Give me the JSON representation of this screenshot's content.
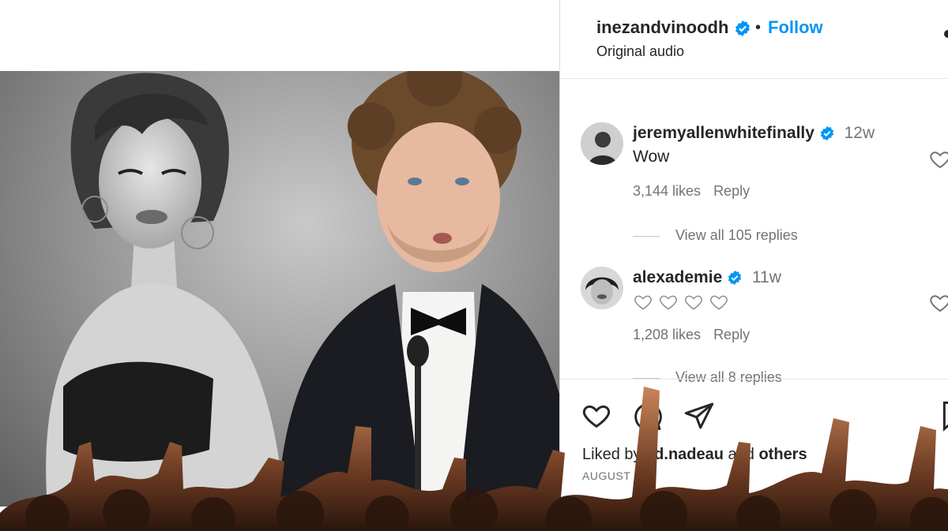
{
  "header": {
    "username": "inezandvinoodh",
    "separator": "•",
    "follow_label": "Follow",
    "audio": "Original audio"
  },
  "comments": [
    {
      "username": "jeremyallenwhitefinally",
      "time": "12w",
      "text": "Wow",
      "likes": "3,144 likes",
      "reply_label": "Reply",
      "view_replies": "View all 105 replies"
    },
    {
      "username": "alexademie",
      "time": "11w",
      "text_icons": [
        "heart-outline-icon",
        "heart-outline-icon",
        "heart-outline-icon",
        "heart-outline-icon"
      ],
      "likes": "1,208 likes",
      "reply_label": "Reply",
      "view_replies": "View all 8 replies"
    }
  ],
  "footer": {
    "liked_prefix": "Liked by ",
    "liked_user": "ed.nadeau",
    "liked_middle": " and ",
    "liked_suffix": "others",
    "date": "AUGUST 16"
  },
  "colors": {
    "accent": "#0095f6",
    "text": "#262626",
    "muted": "#737373"
  }
}
